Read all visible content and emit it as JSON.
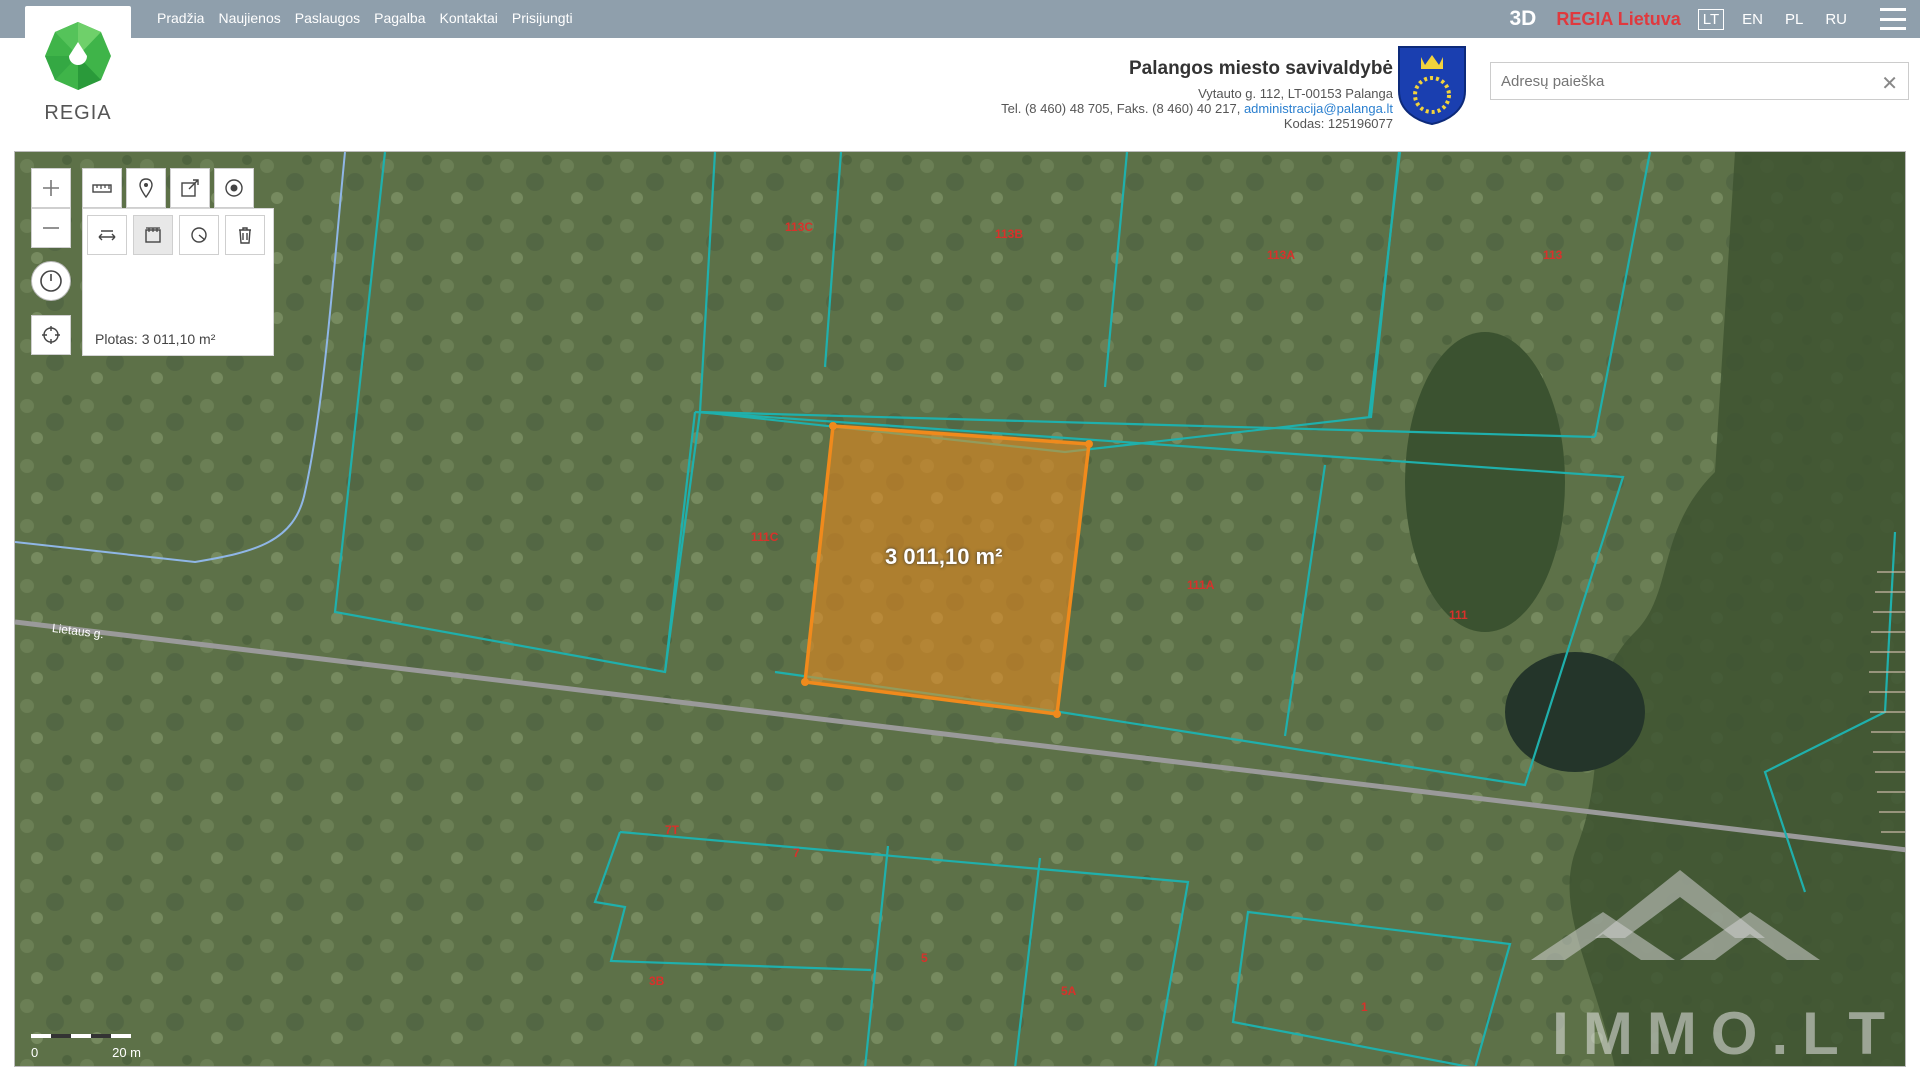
{
  "nav": [
    "Pradžia",
    "Naujienos",
    "Paslaugos",
    "Pagalba",
    "Kontaktai",
    "Prisijungti"
  ],
  "brand": {
    "logo_text": "REGIA",
    "btn_3d": "3D",
    "regia_lt": "REGIA Lietuva"
  },
  "languages": [
    {
      "code": "LT",
      "active": true
    },
    {
      "code": "EN",
      "active": false
    },
    {
      "code": "PL",
      "active": false
    },
    {
      "code": "RU",
      "active": false
    }
  ],
  "municipality": {
    "title": "Palangos miesto savivaldybė",
    "address": "Vytauto g. 112, LT-00153 Palanga",
    "phone": "Tel. (8 460) 48 705, Faks. (8 460) 40 217,",
    "email": "administracija@palanga.lt",
    "code": "Kodas: 125196077"
  },
  "search": {
    "placeholder": "Adresų paieška",
    "clear": "✕"
  },
  "measure": {
    "area_text": "Plotas: 3 011,10 m²",
    "map_label": "3 011,10 m²"
  },
  "street": "Lietaus g.",
  "parcels": [
    "113C",
    "113B",
    "113A",
    "113",
    "111C",
    "111A",
    "111",
    "7T",
    "7",
    "3B",
    "5",
    "5A",
    "1"
  ],
  "scale": {
    "zero": "0",
    "length": "20 m"
  },
  "watermark": "IMMO.LT",
  "colors": {
    "topbar": "#8f9fac",
    "accent_red": "#e0393e",
    "parcel_line": "#1fb0ac",
    "selection": "#f08a1c"
  }
}
